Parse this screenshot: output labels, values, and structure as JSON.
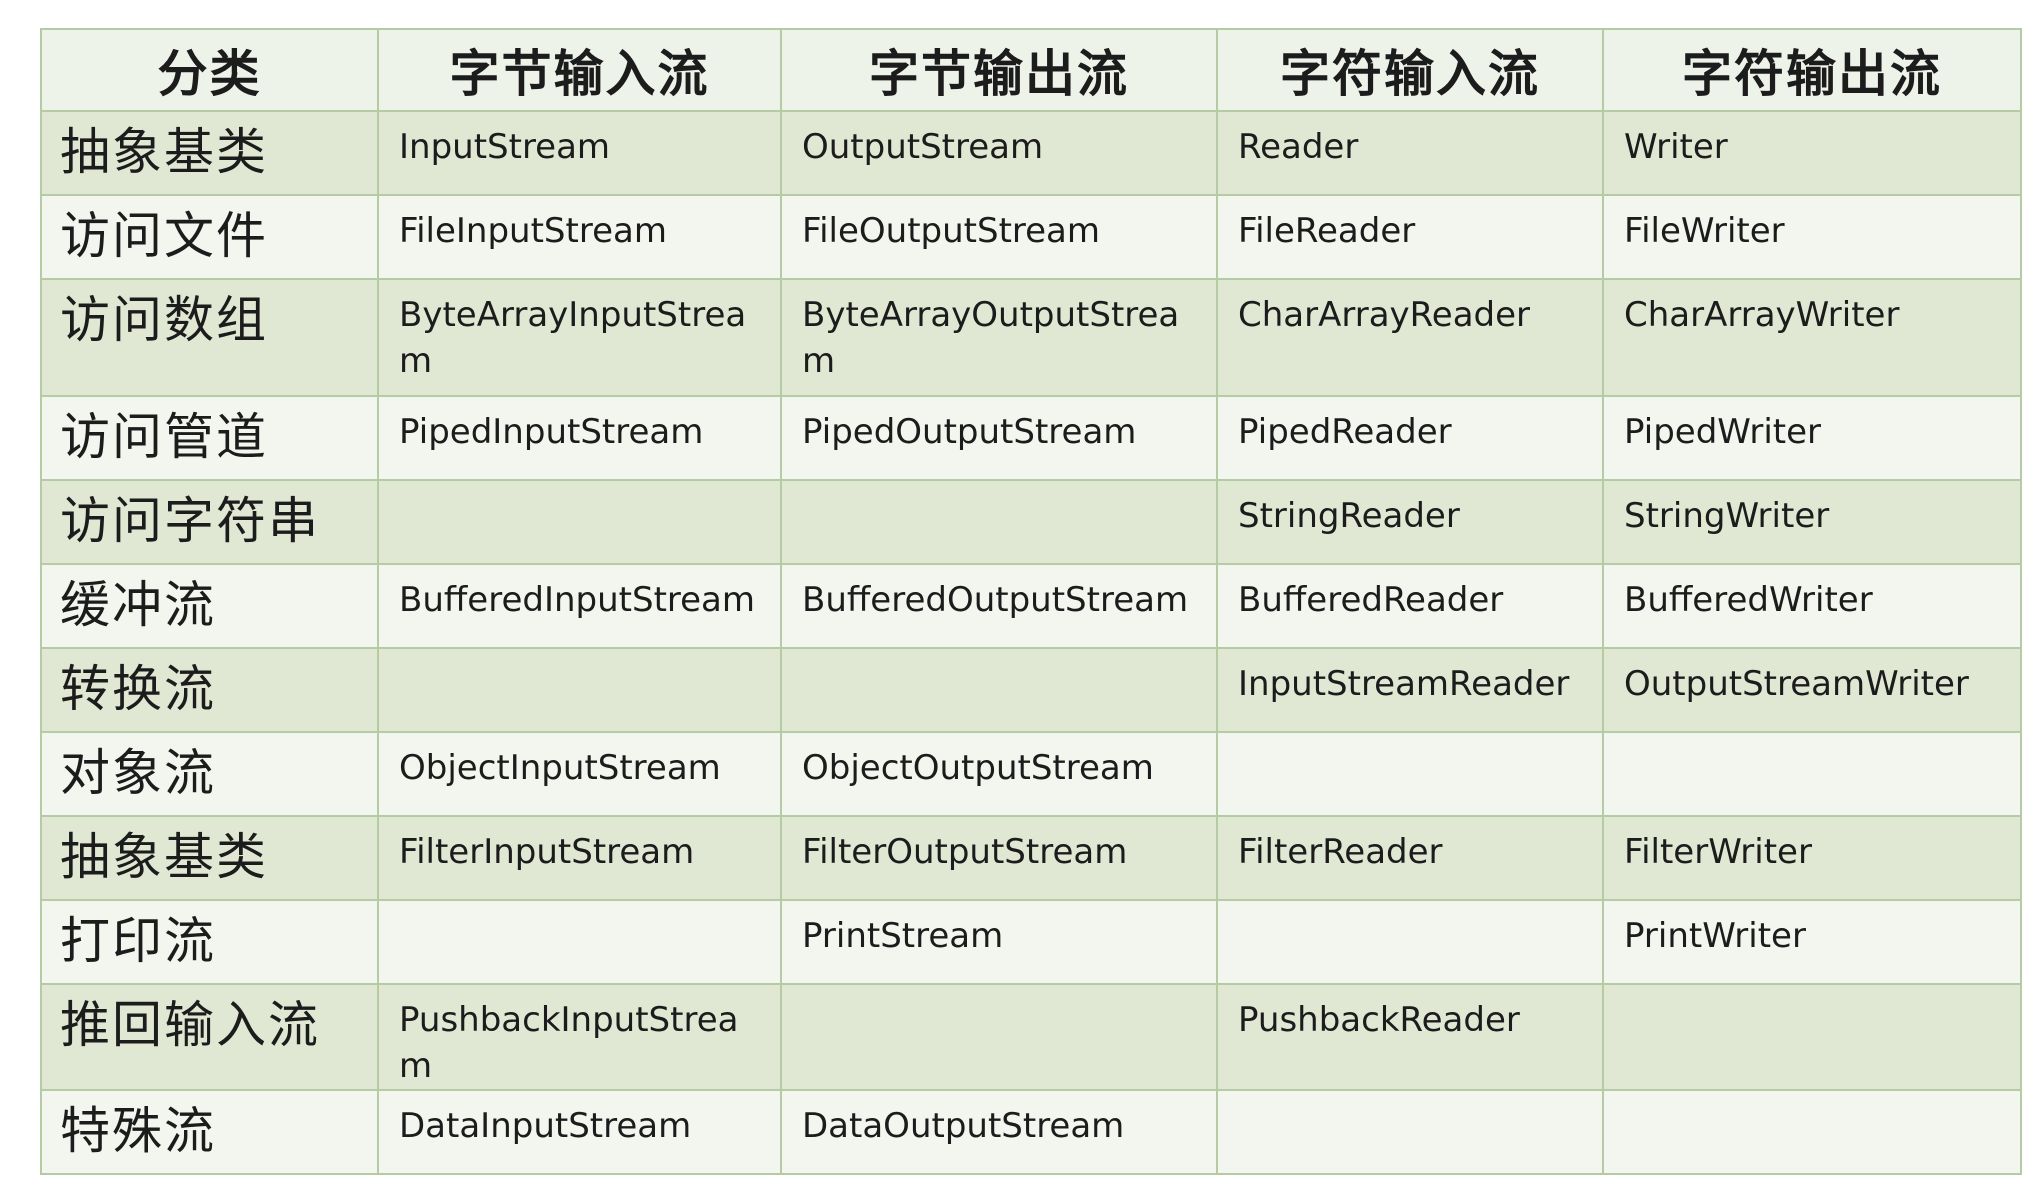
{
  "headers": [
    "分类",
    "字节输入流",
    "字节输出流",
    "字符输入流",
    "字符输出流"
  ],
  "rows": [
    [
      "抽象基类",
      "InputStream",
      "OutputStream",
      "Reader",
      "Writer"
    ],
    [
      "访问文件",
      "FileInputStream",
      "FileOutputStream",
      "FileReader",
      "FileWriter"
    ],
    [
      "访问数组",
      "ByteArrayInputStream",
      "ByteArrayOutputStream",
      "CharArrayReader",
      "CharArrayWriter"
    ],
    [
      "访问管道",
      "PipedInputStream",
      "PipedOutputStream",
      "PipedReader",
      "PipedWriter"
    ],
    [
      "访问字符串",
      "",
      "",
      "StringReader",
      "StringWriter"
    ],
    [
      "缓冲流",
      "BufferedInputStream",
      "BufferedOutputStream",
      "BufferedReader",
      "BufferedWriter"
    ],
    [
      "转换流",
      "",
      "",
      "InputStreamReader",
      "OutputStreamWriter"
    ],
    [
      "对象流",
      "ObjectInputStream",
      "ObjectOutputStream",
      "",
      ""
    ],
    [
      "抽象基类",
      "FilterInputStream",
      "FilterOutputStream",
      "FilterReader",
      "FilterWriter"
    ],
    [
      "打印流",
      "",
      "PrintStream",
      "",
      "PrintWriter"
    ],
    [
      "推回输入流",
      "PushbackInputStream",
      "",
      "PushbackReader",
      ""
    ],
    [
      "特殊流",
      "DataInputStream",
      "DataOutputStream",
      "",
      ""
    ]
  ],
  "colors": {
    "header_bg": "#eef3ea",
    "row_shade": "#e0e8d4",
    "row_light": "#f2f6ef",
    "border": "#b5cba3"
  }
}
